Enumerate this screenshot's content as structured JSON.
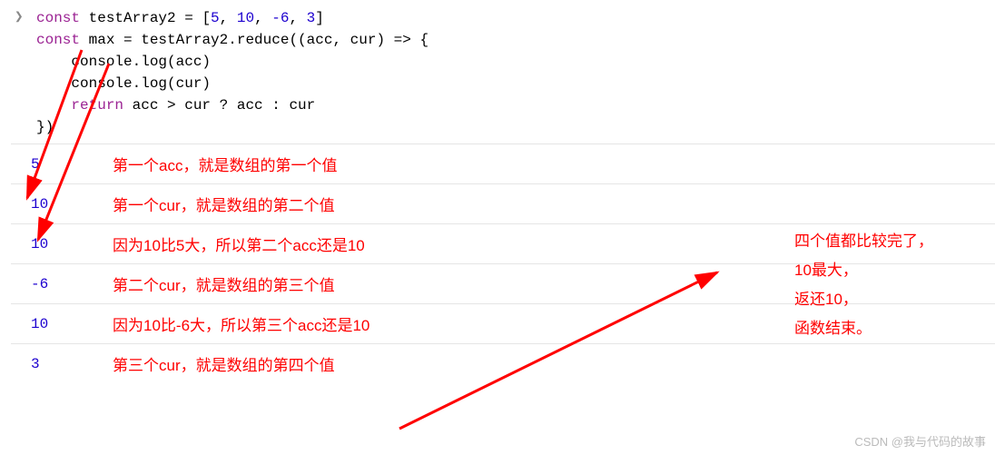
{
  "code": {
    "line1_kw": "const",
    "line1_rest": " testArray2 = [",
    "line1_nums": [
      "5",
      "10",
      "-6",
      "3"
    ],
    "line1_close": "]",
    "line2_kw": "const",
    "line2_rest": " max = testArray2.reduce((acc, cur) => {",
    "line3": "    console.log(acc)",
    "line4": "    console.log(cur)",
    "line5_kw": "return",
    "line5_pre": "    ",
    "line5_rest": " acc > cur ? acc : cur",
    "line6": "})"
  },
  "output_rows": [
    {
      "val": "5",
      "note": "第一个acc，就是数组的第一个值"
    },
    {
      "val": "10",
      "note": "第一个cur，就是数组的第二个值"
    },
    {
      "val": "10",
      "note": "因为10比5大，所以第二个acc还是10"
    },
    {
      "val": "-6",
      "note": "第二个cur，就是数组的第三个值"
    },
    {
      "val": "10",
      "note": "因为10比-6大，所以第三个acc还是10"
    },
    {
      "val": "3",
      "note": "第三个cur，就是数组的第四个值"
    }
  ],
  "right_annotation": {
    "l1": "四个值都比较完了，",
    "l2": "10最大，",
    "l3": "返还10，",
    "l4": "函数结束。"
  },
  "watermark": "CSDN @我与代码的故事",
  "prompt_glyph": "❯"
}
